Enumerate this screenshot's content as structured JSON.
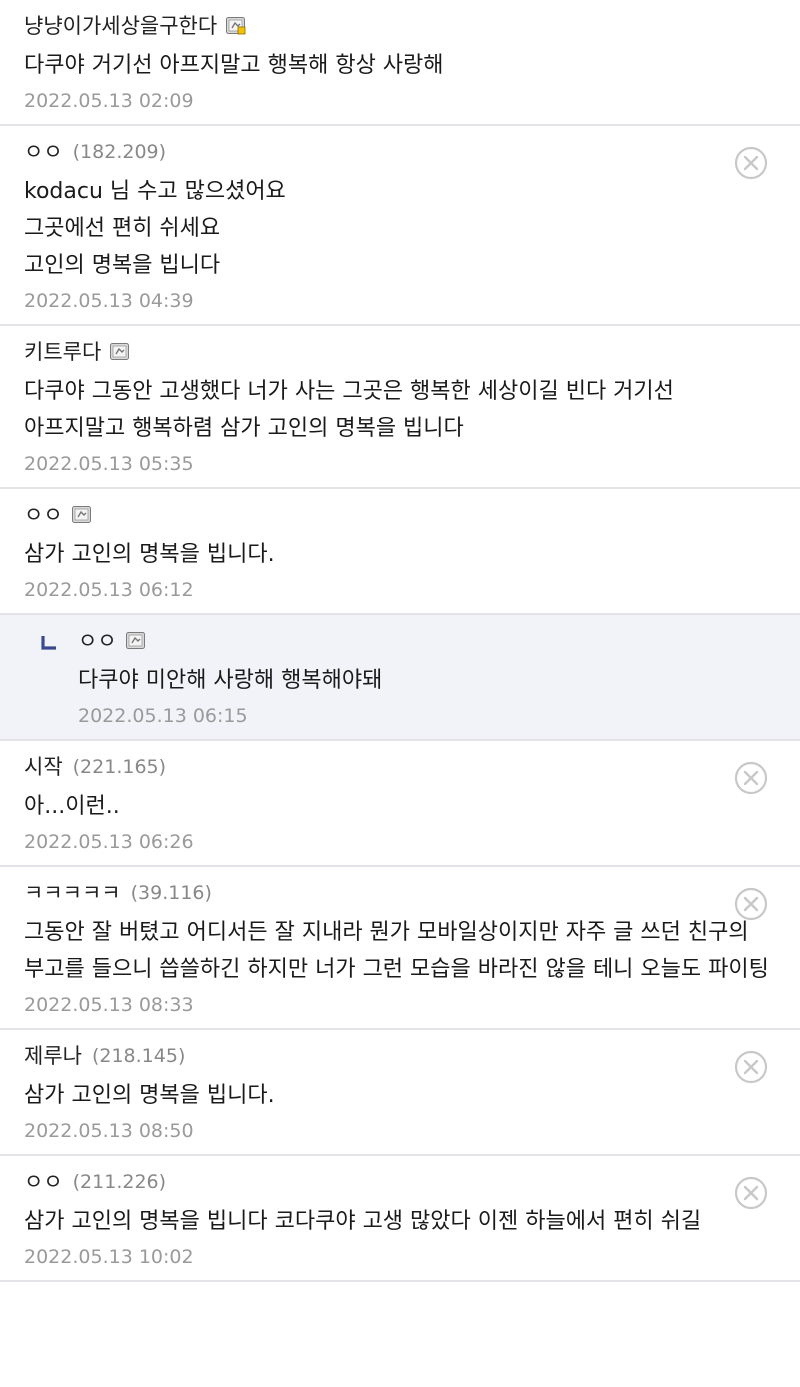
{
  "comments": [
    {
      "author": "냥냥이가세상을구한다",
      "ip": "",
      "badge": "manager-badge-icon",
      "body": [
        "다쿠야 거기선 아프지말고 행복해 항상 사랑해"
      ],
      "date": "2022.05.13 02:09",
      "deletable": false,
      "reply": false
    },
    {
      "author": "ㅇㅇ",
      "ip": "(182.209)",
      "badge": "",
      "body": [
        "kodacu 님 수고 많으셨어요",
        "그곳에선 편히 쉬세요",
        "고인의 명복을 빕니다"
      ],
      "date": "2022.05.13 04:39",
      "deletable": true,
      "reply": false
    },
    {
      "author": "키트루다",
      "ip": "",
      "badge": "member-badge-icon",
      "body": [
        "다쿠야 그동안 고생했다 너가 사는 그곳은 행복한 세상이길 빈다 거기선 아프지말고 행복하렴 삼가 고인의 명복을 빕니다"
      ],
      "date": "2022.05.13 05:35",
      "deletable": false,
      "reply": false
    },
    {
      "author": "ㅇㅇ",
      "ip": "",
      "badge": "member-badge-icon",
      "body": [
        "삼가 고인의 명복을 빕니다."
      ],
      "date": "2022.05.13 06:12",
      "deletable": false,
      "reply": false
    },
    {
      "author": "ㅇㅇ",
      "ip": "",
      "badge": "member-badge-icon",
      "body": [
        "다쿠야 미안해 사랑해 행복해야돼"
      ],
      "date": "2022.05.13 06:15",
      "deletable": false,
      "reply": true
    },
    {
      "author": "시작",
      "ip": "(221.165)",
      "badge": "",
      "body": [
        "아...이런.."
      ],
      "date": "2022.05.13 06:26",
      "deletable": true,
      "reply": false
    },
    {
      "author": "ㅋㅋㅋㅋㅋ",
      "ip": "(39.116)",
      "badge": "",
      "body": [
        "그동안 잘 버텼고 어디서든 잘 지내라 뭔가 모바일상이지만 자주 글 쓰던 친구의 부고를 들으니 씁쓸하긴 하지만 너가 그런 모습을 바라진 않을 테니 오늘도 파이팅"
      ],
      "date": "2022.05.13 08:33",
      "deletable": true,
      "reply": false
    },
    {
      "author": "제루나",
      "ip": "(218.145)",
      "badge": "",
      "body": [
        "삼가 고인의 명복을 빕니다."
      ],
      "date": "2022.05.13 08:50",
      "deletable": true,
      "reply": false
    },
    {
      "author": "ㅇㅇ",
      "ip": "(211.226)",
      "badge": "",
      "body": [
        "삼가 고인의 명복을 빕니다 코다쿠야 고생 많았다 이젠 하늘에서 편히 쉬길"
      ],
      "date": "2022.05.13 10:02",
      "deletable": true,
      "reply": false
    }
  ],
  "colors": {
    "divider": "#e3e3e8",
    "reply_bg": "#f2f3f8",
    "date": "#9a9a9a",
    "ip": "#888888",
    "reply_arrow": "#3b4a8f",
    "delete_icon": "#c8c8c8"
  }
}
